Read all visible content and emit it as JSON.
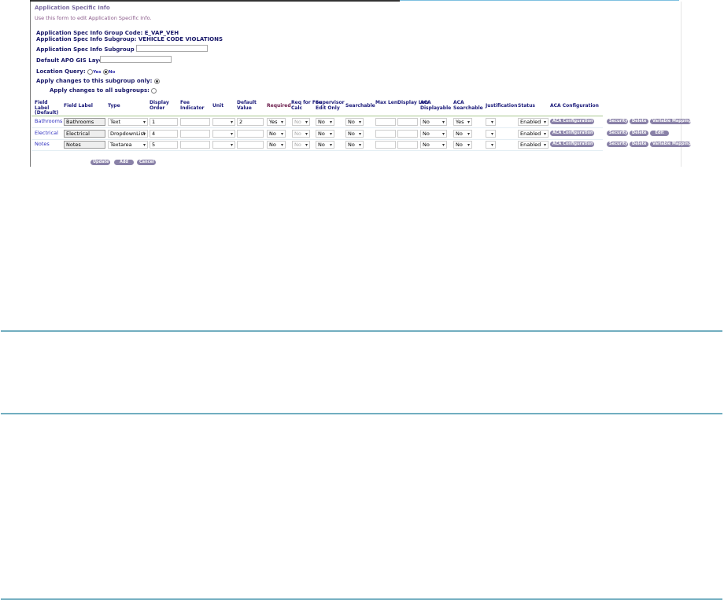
{
  "page": {
    "title": "Application Specific Info",
    "subtitle": "Use this form to edit Application Specific Info."
  },
  "info": {
    "group_code_label": "Application Spec Info Group Code:",
    "group_code": "E_VAP_VEH",
    "subgroup_label": "Application Spec Info Subgroup:",
    "subgroup": "VEHICLE CODE VIOLATIONS",
    "alias_label": "Application Spec Info Subgroup Alias:",
    "alias_value": "",
    "gis_label": "Default APO GIS Layer:",
    "gis_value": "",
    "location_query_label": "Location Query:",
    "location_yes": "Yes",
    "location_no": "No",
    "location_selected": "No",
    "apply_this_label": "Apply changes to this subgroup only:",
    "apply_all_label": "Apply changes to all subgroups:",
    "apply_selected": "this"
  },
  "table": {
    "headers": [
      "Field Label (Default)",
      "Field Label",
      "Type",
      "Display Order",
      "Fee Indicator",
      "Unit",
      "Default Value",
      "Required",
      "Req for Fee Calc",
      "Supervisor Edit Only",
      "Searchable",
      "Max Len",
      "Display Len",
      "ACA Displayable",
      "ACA Searchable",
      "Justification",
      "Status",
      "ACA Configuration"
    ],
    "rows": [
      {
        "default_label": "Bathrooms",
        "label": "Bathrooms",
        "type": "Text",
        "order": "1",
        "fee": "",
        "unit": "",
        "default_value": "2",
        "required": "Yes",
        "req_fee": "No",
        "supervisor": "No",
        "searchable": "No",
        "max_len": "",
        "display_len": "",
        "aca_disp": "No",
        "aca_search": "Yes",
        "justification": "",
        "status": "Enabled",
        "aca_config": "ACA Configuration",
        "actions": [
          "Security",
          "Delete",
          "Variable Mapping"
        ]
      },
      {
        "default_label": "Electrical",
        "label": "Electrical",
        "type": "DropdownList",
        "order": "4",
        "fee": "",
        "unit": "",
        "default_value": "",
        "required": "No",
        "req_fee": "No",
        "supervisor": "No",
        "searchable": "No",
        "max_len": "",
        "display_len": "",
        "aca_disp": "No",
        "aca_search": "No",
        "justification": "",
        "status": "Enabled",
        "aca_config": "ACA Configuration",
        "actions": [
          "Security",
          "Delete",
          "Edit"
        ]
      },
      {
        "default_label": "Notes",
        "label": "Notes",
        "type": "Textarea",
        "order": "5",
        "fee": "",
        "unit": "",
        "default_value": "",
        "required": "No",
        "req_fee": "No",
        "supervisor": "No",
        "searchable": "No",
        "max_len": "",
        "display_len": "",
        "aca_disp": "No",
        "aca_search": "No",
        "justification": "",
        "status": "Enabled",
        "aca_config": "ACA Configuration",
        "actions": [
          "Security",
          "Delete",
          "Variable Mapping"
        ]
      }
    ]
  },
  "buttons": {
    "update": "Update",
    "add": "Add",
    "cancel": "Cancel"
  },
  "colors": {
    "accent": "#8a82a8",
    "divider": "#72aec0",
    "title": "#7a6aa0"
  }
}
